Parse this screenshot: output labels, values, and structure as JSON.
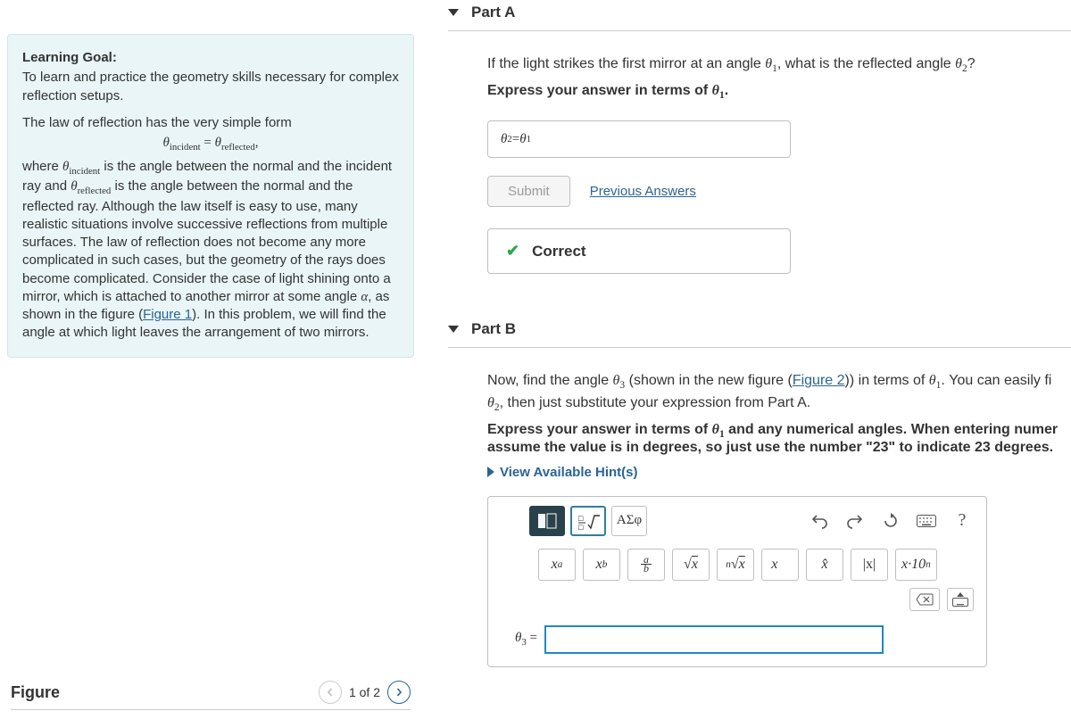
{
  "left": {
    "goal_title": "Learning Goal:",
    "goal_text": "To learn and practice the geometry skills necessary for complex reflection setups.",
    "law_intro": "The law of reflection has the very simple form",
    "law_eq_lhs": "θ",
    "law_eq_sub1": "incident",
    "law_eq_eq": " = ",
    "law_eq_rhs": "θ",
    "law_eq_sub2": "reflected",
    "law_eq_comma": ",",
    "body1a": "where ",
    "body1b": "θ",
    "body1b_sub": "incident",
    "body1c": " is the angle between the normal and the incident ray and ",
    "body1d": "θ",
    "body1d_sub": "reflected",
    "body1e": " is the angle between the normal and the reflected ray. Although the law itself is easy to use, many realistic situations involve successive reflections from multiple surfaces. The law of reflection does not become any more complicated in such cases, but the geometry of the rays does become complicated. Consider the case of light shining onto a mirror, which is attached to another mirror at some angle ",
    "body1f": "α",
    "body1g": ", as shown in the figure (",
    "fig1_link": "Figure 1",
    "body1h": "). In this problem, we will find the angle at which light leaves the arrangement of two mirrors.",
    "figure_title": "Figure",
    "pager_text": "1 of 2"
  },
  "partA": {
    "title": "Part A",
    "q1a": "If the light strikes the first mirror at an angle ",
    "q1b": "θ",
    "q1c": "1",
    "q1d": ", what is the reflected angle ",
    "q1e": "θ",
    "q1f": "2",
    "q1g": "?",
    "instr_a": "Express your answer in terms of ",
    "instr_b": "θ",
    "instr_c": "1",
    "instr_d": ".",
    "ans_lhs": "θ",
    "ans_lhs_sub": "2",
    "ans_eq": " = ",
    "ans_rhs": "θ",
    "ans_rhs_sub": "1",
    "submit": "Submit",
    "prev": "Previous Answers",
    "correct": "Correct"
  },
  "partB": {
    "title": "Part B",
    "p1a": "Now, find the angle ",
    "p1b": "θ",
    "p1c": "3",
    "p1d": " (shown in the new figure (",
    "fig2": "Figure 2",
    "p1e": ")) in terms of ",
    "p1f": "θ",
    "p1g": "1",
    "p1h": ". You can easily fi",
    "p2a": "θ",
    "p2b": "2",
    "p2c": ", then just substitute your expression from Part A.",
    "instr_a": "Express your answer in terms of ",
    "instr_b": "θ",
    "instr_c": "1",
    "instr_d": " and any numerical angles. When entering numer",
    "instr_e": "assume the value is in degrees, so just use the number \"23\" to indicate 23 degrees.",
    "hints": "View Available Hint(s)",
    "greek_btn": "ΑΣφ",
    "help_q": "?",
    "m_xa": "x",
    "m_xa_sup": "a",
    "m_xb": "x",
    "m_xb_sub": "b",
    "m_ab_a": "a",
    "m_ab_b": "b",
    "m_sqrt": "√x",
    "m_nroot": "ⁿ√x",
    "m_vec": "x⃗",
    "m_hat": "x̂",
    "m_abs": "|x|",
    "m_sci_x": "x·10",
    "m_sci_n": "n",
    "ans_label_a": "θ",
    "ans_label_b": "3",
    "ans_label_eq": " ="
  }
}
